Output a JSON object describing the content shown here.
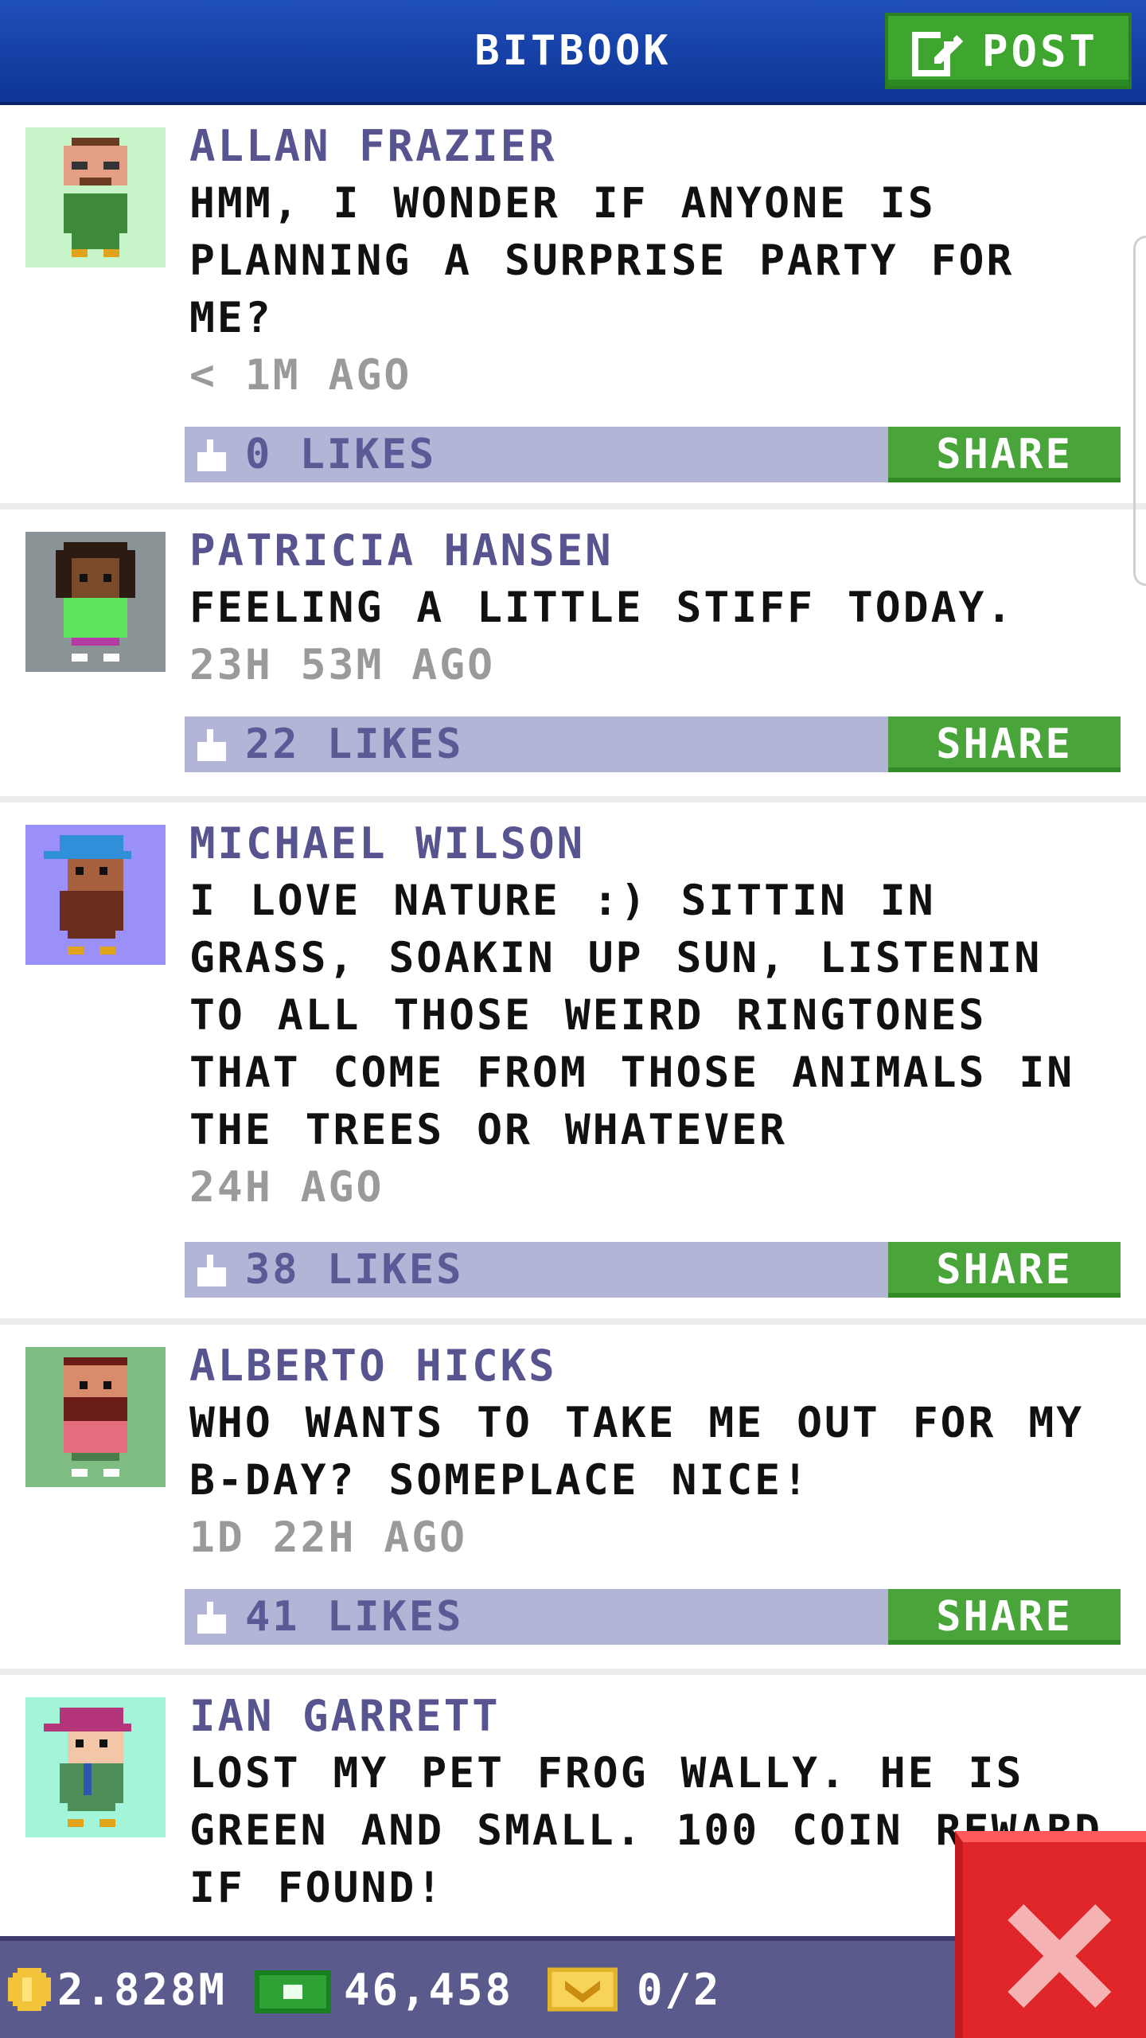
{
  "header": {
    "title": "BITBOOK",
    "post_label": "POST"
  },
  "posts": [
    {
      "author": "ALLAN FRAZIER",
      "text": "HMM, I WONDER IF ANYONE IS PLANNING A SURPRISE PARTY FOR ME?",
      "time": "< 1M AGO",
      "likes": "0 LIKES",
      "share": "SHARE",
      "avatar_bg": "#c8f4c9"
    },
    {
      "author": "PATRICIA HANSEN",
      "text": "FEELING A LITTLE STIFF TODAY.",
      "time": "23H 53M AGO",
      "likes": "22 LIKES",
      "share": "SHARE",
      "avatar_bg": "#8a9396"
    },
    {
      "author": "MICHAEL WILSON",
      "text": "I LOVE NATURE :) SITTIN IN GRASS, SOAKIN UP SUN, LISTENIN TO ALL THOSE WEIRD RINGTONES THAT COME FROM THOSE ANIMALS IN THE TREES OR WHATEVER",
      "time": "24H AGO",
      "likes": "38 LIKES",
      "share": "SHARE",
      "avatar_bg": "#9b90f7"
    },
    {
      "author": "ALBERTO HICKS",
      "text": "WHO WANTS TO TAKE ME OUT FOR MY B-DAY? SOMEPLACE NICE!",
      "time": "1D 22H AGO",
      "likes": "41 LIKES",
      "share": "SHARE",
      "avatar_bg": "#7fbd82"
    },
    {
      "author": "IAN GARRETT",
      "text": "LOST MY PET FROG WALLY. HE IS GREEN AND SMALL. 100 COIN REWARD IF FOUND!",
      "avatar_bg": "#a3f5d9"
    }
  ],
  "footer": {
    "coins": "2.828M",
    "bux": "46,458",
    "tickets": "0/2"
  },
  "colors": {
    "header": "#1f4fb8",
    "share": "#49a53a",
    "likes_bar": "#b2b5d6",
    "author": "#57548f",
    "close": "#e0262a"
  }
}
